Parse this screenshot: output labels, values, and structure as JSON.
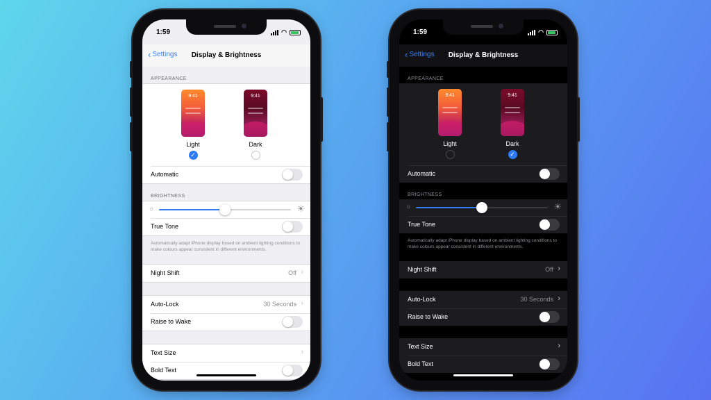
{
  "phones": [
    {
      "theme": "light",
      "status": {
        "time": "1:59"
      },
      "nav": {
        "back_label": "Settings",
        "title": "Display & Brightness"
      },
      "appearance": {
        "header": "APPEARANCE",
        "thumb_time": "9:41",
        "options": [
          {
            "label": "Light",
            "selected": true
          },
          {
            "label": "Dark",
            "selected": false
          }
        ],
        "automatic_label": "Automatic",
        "automatic_on": false
      },
      "brightness": {
        "header": "BRIGHTNESS",
        "level": 0.5,
        "true_tone_label": "True Tone",
        "true_tone_on": false,
        "true_tone_note": "Automatically adapt iPhone display based on ambient lighting conditions to make colours appear consistent in different environments."
      },
      "night_shift": {
        "label": "Night Shift",
        "value": "Off"
      },
      "auto_lock": {
        "label": "Auto-Lock",
        "value": "30 Seconds"
      },
      "raise_to_wake": {
        "label": "Raise to Wake",
        "on": false
      },
      "text_size": {
        "label": "Text Size"
      },
      "bold_text": {
        "label": "Bold Text"
      }
    },
    {
      "theme": "dark",
      "status": {
        "time": "1:59"
      },
      "nav": {
        "back_label": "Settings",
        "title": "Display & Brightness"
      },
      "appearance": {
        "header": "APPEARANCE",
        "thumb_time": "9:41",
        "options": [
          {
            "label": "Light",
            "selected": false
          },
          {
            "label": "Dark",
            "selected": true
          }
        ],
        "automatic_label": "Automatic",
        "automatic_on": false
      },
      "brightness": {
        "header": "BRIGHTNESS",
        "level": 0.5,
        "true_tone_label": "True Tone",
        "true_tone_on": false,
        "true_tone_note": "Automatically adapt iPhone display based on ambient lighting conditions to make colours appear consistent in different environments."
      },
      "night_shift": {
        "label": "Night Shift",
        "value": "Off"
      },
      "auto_lock": {
        "label": "Auto-Lock",
        "value": "30 Seconds"
      },
      "raise_to_wake": {
        "label": "Raise to Wake",
        "on": false
      },
      "text_size": {
        "label": "Text Size"
      },
      "bold_text": {
        "label": "Bold Text"
      }
    }
  ],
  "colors": {
    "accent": "#2d7cf6",
    "background_start": "#5fd6ec",
    "background_end": "#5872f2"
  }
}
